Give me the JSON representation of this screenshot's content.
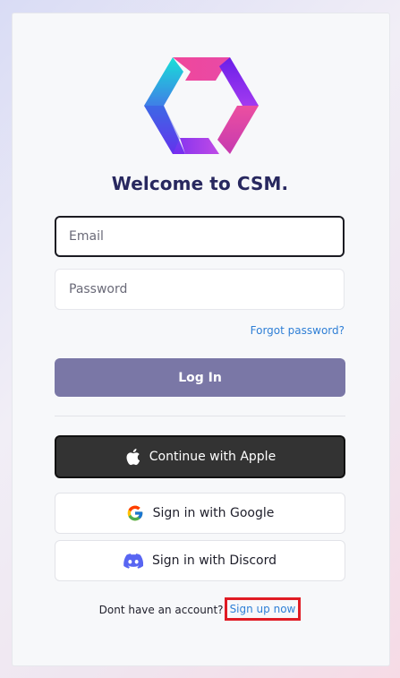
{
  "brand": {
    "logo_icon": "csm-hexagon-logo",
    "accent_colors": [
      "#1fd0d8",
      "#7b3ff2",
      "#f0479b",
      "#b04fe8"
    ]
  },
  "header": {
    "title": "Welcome to CSM."
  },
  "form": {
    "email_placeholder": "Email",
    "email_value": "",
    "password_placeholder": "Password",
    "password_value": "",
    "forgot_label": "Forgot password?",
    "login_label": "Log In",
    "login_color": "#7a77a6"
  },
  "social": {
    "apple_label": "Continue with Apple",
    "apple_icon": "apple-icon",
    "google_label": "Sign in with Google",
    "google_icon": "google-icon",
    "discord_label": "Sign in with Discord",
    "discord_icon": "discord-icon"
  },
  "footer": {
    "prompt": "Dont have an account?",
    "signup_label": "Sign up now",
    "highlight_color": "#e01b24"
  }
}
